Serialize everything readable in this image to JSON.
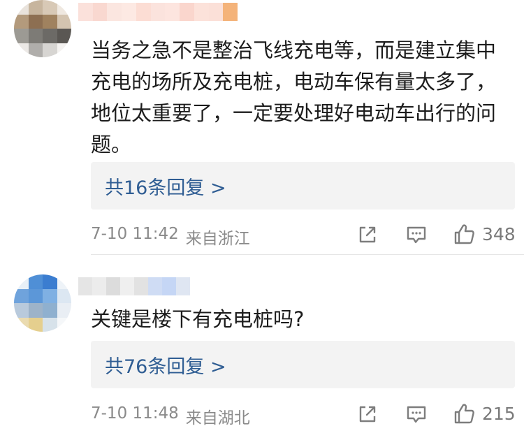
{
  "comments": [
    {
      "text": "当务之急不是整治飞线充电等，而是建立集中充电的场所及充电桩，电动车保有量太多了，地位太重要了，一定要处理好电动车出行的问题。",
      "replies_label": "共16条回复 >",
      "time": "7-10 11:42",
      "location": "来自浙江",
      "likes": "348"
    },
    {
      "text": "关键是楼下有充电桩吗?",
      "replies_label": "共76条回复 >",
      "time": "7-10 11:48",
      "location": "来自湖北",
      "likes": "215"
    }
  ],
  "colors": {
    "reply_link": "#2f5d93",
    "meta_text": "#8a8a8a",
    "reply_box_bg": "#f3f3f3"
  },
  "icons": [
    "share-icon",
    "comment-icon",
    "thumbs-up-icon"
  ]
}
